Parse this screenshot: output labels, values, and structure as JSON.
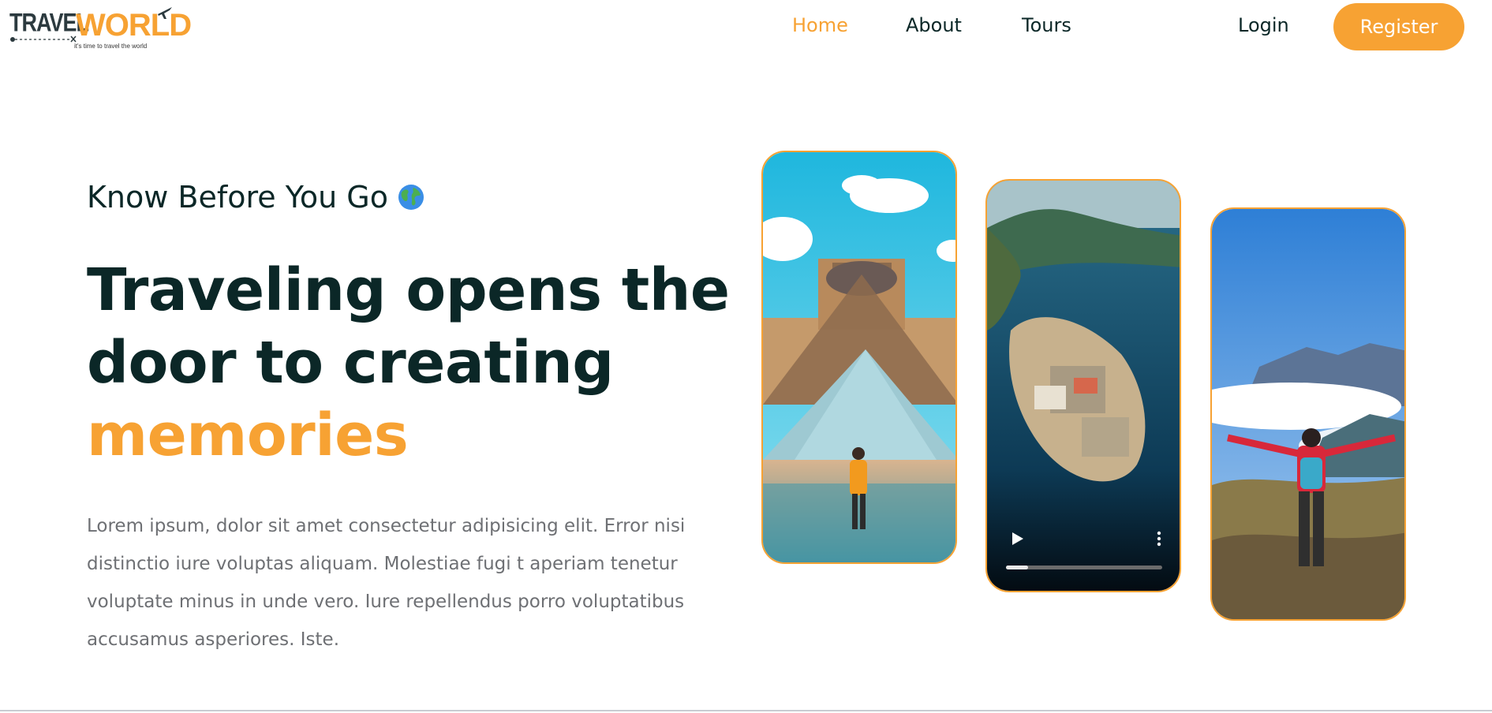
{
  "brand": {
    "logo_word1": "TRAVEL",
    "logo_word2": "WORLD",
    "tagline": "it's time to travel the world"
  },
  "nav": {
    "items": [
      {
        "label": "Home",
        "active": true
      },
      {
        "label": "About",
        "active": false
      },
      {
        "label": "Tours",
        "active": false
      }
    ],
    "login_label": "Login",
    "register_label": "Register"
  },
  "hero": {
    "subtitle": "Know Before You Go",
    "subtitle_icon": "globe-icon",
    "headline_line1": "Traveling opens the",
    "headline_line2": "door to creating",
    "headline_highlight": "memories",
    "paragraph": "Lorem ipsum, dolor sit amet consectetur adipisicing elit. Error nisi distinctio iure voluptas aliquam. Molestiae fugi t aperiam tenetur voluptate minus in unde vero. Iure repellendus porro voluptatibus accusamus asperiores. Iste."
  },
  "media": {
    "video_progress": 0.14,
    "video_controls": [
      "play-icon",
      "more-vertical-icon"
    ]
  },
  "colors": {
    "accent": "#f7a233",
    "heading": "#0b2727",
    "text_muted": "#6e7074"
  }
}
